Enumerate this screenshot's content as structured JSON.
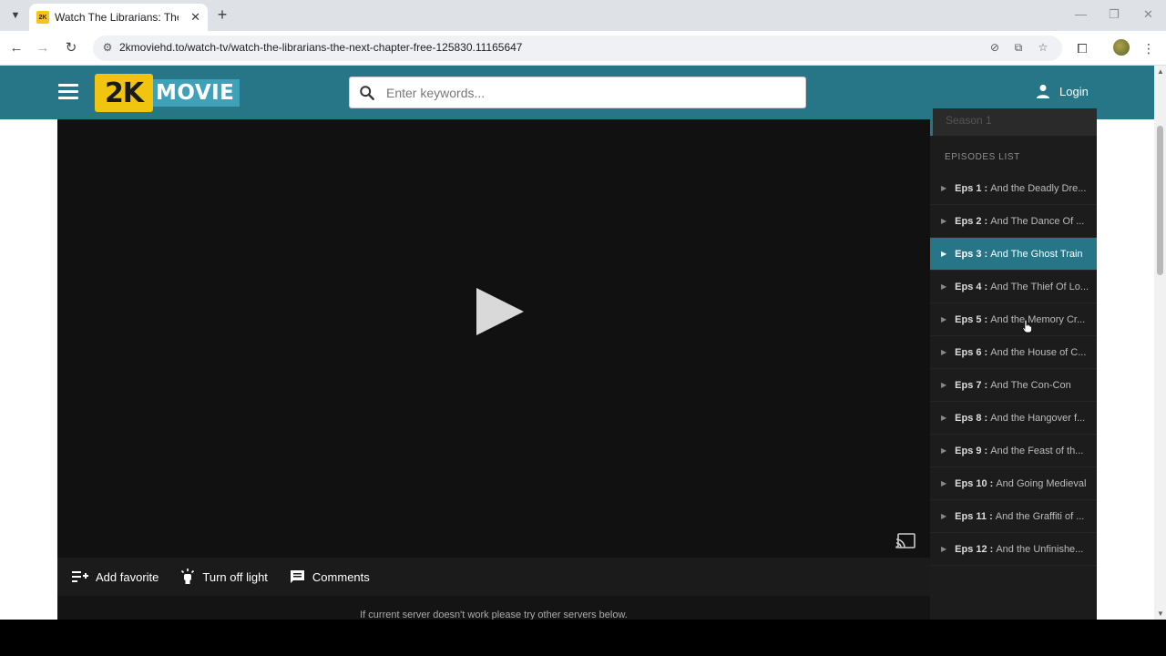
{
  "browser": {
    "tab_title": "Watch The Librarians: The Next",
    "favicon_text": "2K",
    "url": "2kmoviehd.to/watch-tv/watch-the-librarians-the-next-chapter-free-125830.11165647"
  },
  "site": {
    "logo_mark": "2K",
    "logo_word": "MOVIE",
    "search_placeholder": "Enter keywords...",
    "login_label": "Login"
  },
  "sidebar": {
    "season_label": "Season 1",
    "episodes_header": "EPISODES LIST",
    "episodes": [
      {
        "num": "Eps 1 :",
        "title": "And the Deadly Dre..."
      },
      {
        "num": "Eps 2 :",
        "title": "And The Dance Of ..."
      },
      {
        "num": "Eps 3 :",
        "title": "And The Ghost Train"
      },
      {
        "num": "Eps 4 :",
        "title": "And The Thief Of Lo..."
      },
      {
        "num": "Eps 5 :",
        "title": "And the Memory Cr..."
      },
      {
        "num": "Eps 6 :",
        "title": "And the House of C..."
      },
      {
        "num": "Eps 7 :",
        "title": "And The Con-Con"
      },
      {
        "num": "Eps 8 :",
        "title": "And the Hangover f..."
      },
      {
        "num": "Eps 9 :",
        "title": "And the Feast of th..."
      },
      {
        "num": "Eps 10 :",
        "title": "And Going Medieval"
      },
      {
        "num": "Eps 11 :",
        "title": "And the Graffiti of ..."
      },
      {
        "num": "Eps 12 :",
        "title": "And the Unfinishe..."
      }
    ],
    "active_index": 2
  },
  "actions": {
    "add_favorite": "Add favorite",
    "turn_off_light": "Turn off light",
    "comments": "Comments"
  },
  "server_note": "If current server doesn't work please try other servers below.",
  "colors": {
    "header": "#277687",
    "active_episode": "#277687",
    "logo_yellow": "#f1c40f"
  }
}
